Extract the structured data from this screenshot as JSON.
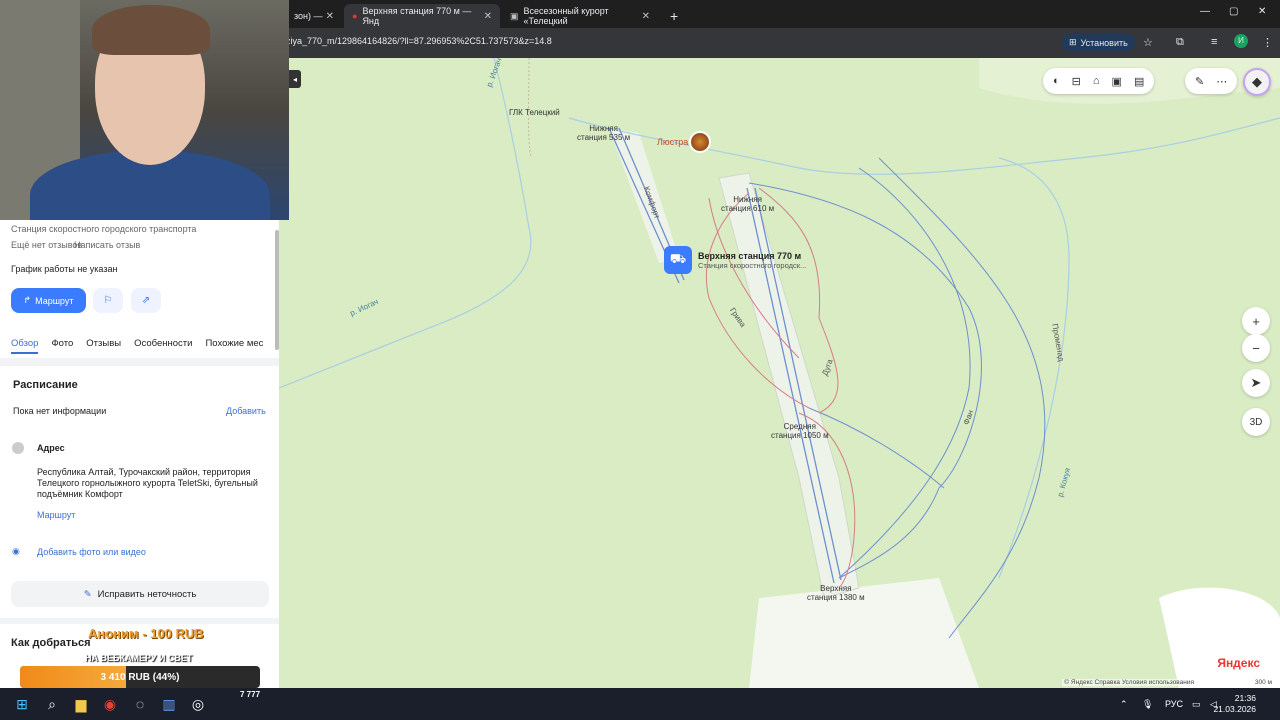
{
  "browser": {
    "tabs": [
      {
        "label": "зон) — ",
        "active": false
      },
      {
        "label": "Верхняя станция 770 м — Янд",
        "active": true
      },
      {
        "label": "Всесезонный курорт «Телецкий",
        "active": false
      }
    ],
    "url": "ziya_770_m/129864164826/?ll=87.296953%2C51.737573&z=14.8",
    "install_label": "Установить"
  },
  "panel": {
    "subtitle": "Станция скоростного городского транспорта",
    "reviews": "Ещё нет отзывов",
    "write_review": "Написать отзыв",
    "schedule_note": "График работы не указан",
    "route_button": "Маршрут",
    "tabs": [
      "Обзор",
      "Фото",
      "Отзывы",
      "Особенности",
      "Похожие мес"
    ],
    "schedule_title": "Расписание",
    "no_info": "Пока нет информации",
    "add_label": "Добавить",
    "address_title": "Адрес",
    "address_text": "Республика Алтай, Турочакский район, территория Телецкого горнолыжного курорта TeletSki, бугельный подъёмник Комфорт",
    "address_route": "Маршрут",
    "add_photo": "Добавить фото или видео",
    "fix_button": "Исправить неточность",
    "how_to_get": "Как добраться"
  },
  "stream": {
    "donation_title": "Аноним - 100 RUB",
    "donation_sub": "НА ВЕБКАМЕРУ И СВЕТ",
    "goal_label": "3 410 RUB (44%)",
    "goal_progress": 0.44,
    "viewers": "7 777"
  },
  "map": {
    "place_title": "Верхняя станция 770 м",
    "place_sub": "Станция скоростного городск...",
    "labels": {
      "glk": "ГЛК Телецкий",
      "lower535": "Нижняя\nстанция 535 м",
      "lustra": "Люстра",
      "lower610": "Нижняя\nстанция 610 м",
      "middle1050": "Средняя\nстанция 1050 м",
      "upper1380": "Верхняя\nстанция 1380 м",
      "river_iogach": "р. Иогач",
      "river_iogach2": "р. Иогач",
      "river_kokuya": "р. Кокуя",
      "komfort": "Комфорт",
      "griva": "Грива",
      "duga": "Дуга",
      "fan": "Фан",
      "promenad": "Променад"
    },
    "copyright": "© Яндекс   Справка   Условия использования",
    "scale": "300 м",
    "logo": "Яндекс"
  },
  "taskbar": {
    "lang": "РУС",
    "time": "21:36",
    "date": "21.03.2026"
  }
}
